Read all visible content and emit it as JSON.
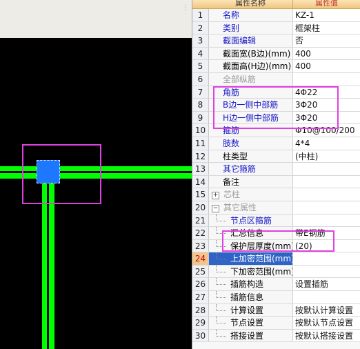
{
  "header": {
    "name_col": "属性名称",
    "value_col": "属性值"
  },
  "rows": [
    {
      "num": "1",
      "name": "名称",
      "value": "KZ-1",
      "style": "blue"
    },
    {
      "num": "2",
      "name": "类别",
      "value": "框架柱",
      "style": "blue"
    },
    {
      "num": "3",
      "name": "截面编辑",
      "value": "否",
      "style": "blue"
    },
    {
      "num": "4",
      "name": "截面宽(B边)(mm)",
      "value": "400",
      "style": ""
    },
    {
      "num": "5",
      "name": "截面高(H边)(mm)",
      "value": "400",
      "style": ""
    },
    {
      "num": "6",
      "name": "全部纵筋",
      "value": "",
      "style": "gray"
    },
    {
      "num": "7",
      "name": "角筋",
      "value": "4Φ22",
      "style": "blue"
    },
    {
      "num": "8",
      "name": "B边一侧中部筋",
      "value": "3Φ20",
      "style": "blue"
    },
    {
      "num": "9",
      "name": "H边一侧中部筋",
      "value": "3Φ20",
      "style": "blue"
    },
    {
      "num": "10",
      "name": "箍筋",
      "value": "Φ10@100/200",
      "style": "blue"
    },
    {
      "num": "11",
      "name": "肢数",
      "value": "4*4",
      "style": "blue"
    },
    {
      "num": "12",
      "name": "柱类型",
      "value": "(中柱)",
      "style": ""
    },
    {
      "num": "13",
      "name": "其它箍筋",
      "value": "",
      "style": "blue"
    },
    {
      "num": "14",
      "name": "备注",
      "value": "",
      "style": ""
    },
    {
      "num": "15",
      "name": "芯柱",
      "value": "",
      "style": "gray group",
      "expander": "+"
    },
    {
      "num": "20",
      "name": "其它属性",
      "value": "",
      "style": "gray group",
      "expander": "−"
    },
    {
      "num": "21",
      "name": "节点区箍筋",
      "value": "",
      "style": "blue child"
    },
    {
      "num": "22",
      "name": "汇总信息",
      "value": "带E钢筋",
      "style": "child"
    },
    {
      "num": "23",
      "name": "保护层厚度(mm)",
      "value": "(20)",
      "style": "child"
    },
    {
      "num": "24",
      "name": "上加密范围(mm)",
      "value": "",
      "style": "child",
      "selected": true
    },
    {
      "num": "25",
      "name": "下加密范围(mm)",
      "value": "",
      "style": "child"
    },
    {
      "num": "26",
      "name": "插筋构造",
      "value": "设置插筋",
      "style": "child"
    },
    {
      "num": "27",
      "name": "插筋信息",
      "value": "",
      "style": "child"
    },
    {
      "num": "28",
      "name": "计算设置",
      "value": "按默认计算设置",
      "style": "child"
    },
    {
      "num": "29",
      "name": "节点设置",
      "value": "按默认节点设置",
      "style": "child"
    },
    {
      "num": "30",
      "name": "搭接设置",
      "value": "按默认搭接设置",
      "style": "child"
    }
  ],
  "colors": {
    "canvas_bg": "#000000",
    "beam": "#00ff00",
    "column": "#1e78ff",
    "highlight": "#e040e0",
    "selected_row": "#2f64c6"
  }
}
